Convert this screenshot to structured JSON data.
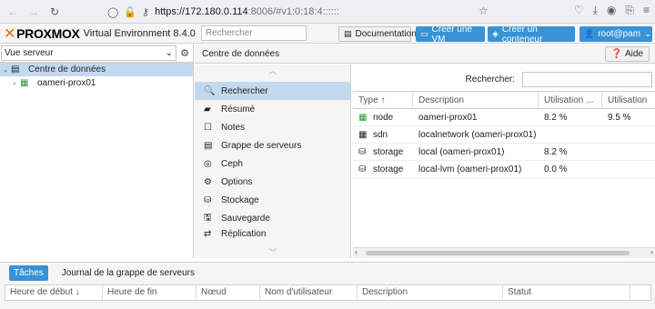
{
  "browser": {
    "url_host": "https://172.180.0.114",
    "url_rest": ":8006/#v1:0:18:4::::::"
  },
  "header": {
    "brand": "PROXMOX",
    "version": "Virtual Environment 8.4.0",
    "search_placeholder": "Rechercher",
    "documentation": "Documentation",
    "create_vm": "Créer une VM",
    "create_ct": "Créer un conteneur",
    "user": "root@pam"
  },
  "left": {
    "view": "Vue serveur",
    "tree": [
      {
        "label": "Centre de données",
        "icon": "datacenter-icon"
      },
      {
        "label": "oameri-prox01",
        "icon": "node-icon"
      }
    ]
  },
  "center": {
    "title": "Centre de données",
    "help": "Aide",
    "menu": [
      {
        "label": "Rechercher",
        "icon": "search-icon"
      },
      {
        "label": "Résumé",
        "icon": "book-icon"
      },
      {
        "label": "Notes",
        "icon": "note-icon"
      },
      {
        "label": "Grappe de serveurs",
        "icon": "cluster-icon"
      },
      {
        "label": "Ceph",
        "icon": "ceph-icon"
      },
      {
        "label": "Options",
        "icon": "gear-icon"
      },
      {
        "label": "Stockage",
        "icon": "database-icon"
      },
      {
        "label": "Sauvegarde",
        "icon": "save-icon"
      },
      {
        "label": "Réplication",
        "icon": "retweet-icon"
      }
    ]
  },
  "grid": {
    "search_label": "Rechercher:",
    "columns": [
      "Type ↑",
      "Description",
      "Utilisation ...",
      "Utilisation"
    ],
    "rows": [
      {
        "type": "node",
        "icon": "node-icon",
        "description": "oameri-prox01",
        "usage1": "8.2 %",
        "usage2": "9.5 %"
      },
      {
        "type": "sdn",
        "icon": "sdn-icon",
        "description": "localnetwork (oameri-prox01)",
        "usage1": "",
        "usage2": ""
      },
      {
        "type": "storage",
        "icon": "database-icon",
        "description": "local (oameri-prox01)",
        "usage1": "8.2 %",
        "usage2": ""
      },
      {
        "type": "storage",
        "icon": "database-icon",
        "description": "local-lvm (oameri-prox01)",
        "usage1": "0.0 %",
        "usage2": ""
      }
    ]
  },
  "log": {
    "tabs": [
      "Tâches",
      "Journal de la grappe de serveurs"
    ],
    "columns": [
      "Heure de début ↓",
      "Heure de fin",
      "Nœud",
      "Nom d'utilisateur",
      "Description",
      "Statut"
    ]
  },
  "colors": {
    "accent": "#3892d4",
    "brand": "#e57000",
    "selection": "#c3d9ee"
  }
}
